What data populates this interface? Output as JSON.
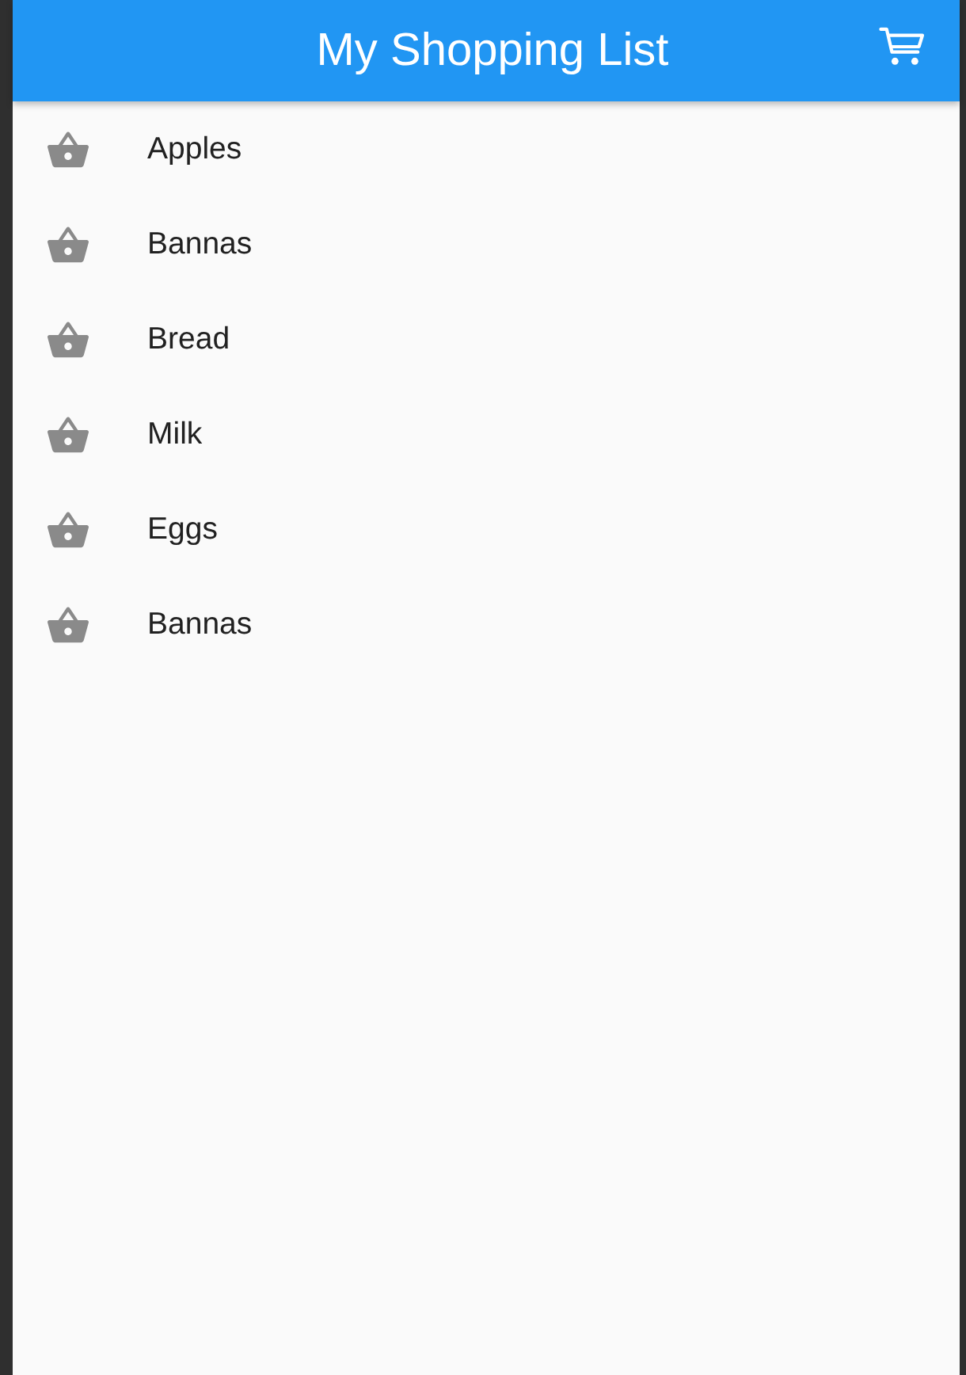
{
  "app_bar": {
    "title": "My Shopping List"
  },
  "items": [
    {
      "label": "Apples"
    },
    {
      "label": "Bannas"
    },
    {
      "label": "Bread"
    },
    {
      "label": "Milk"
    },
    {
      "label": "Eggs"
    },
    {
      "label": "Bannas"
    }
  ]
}
